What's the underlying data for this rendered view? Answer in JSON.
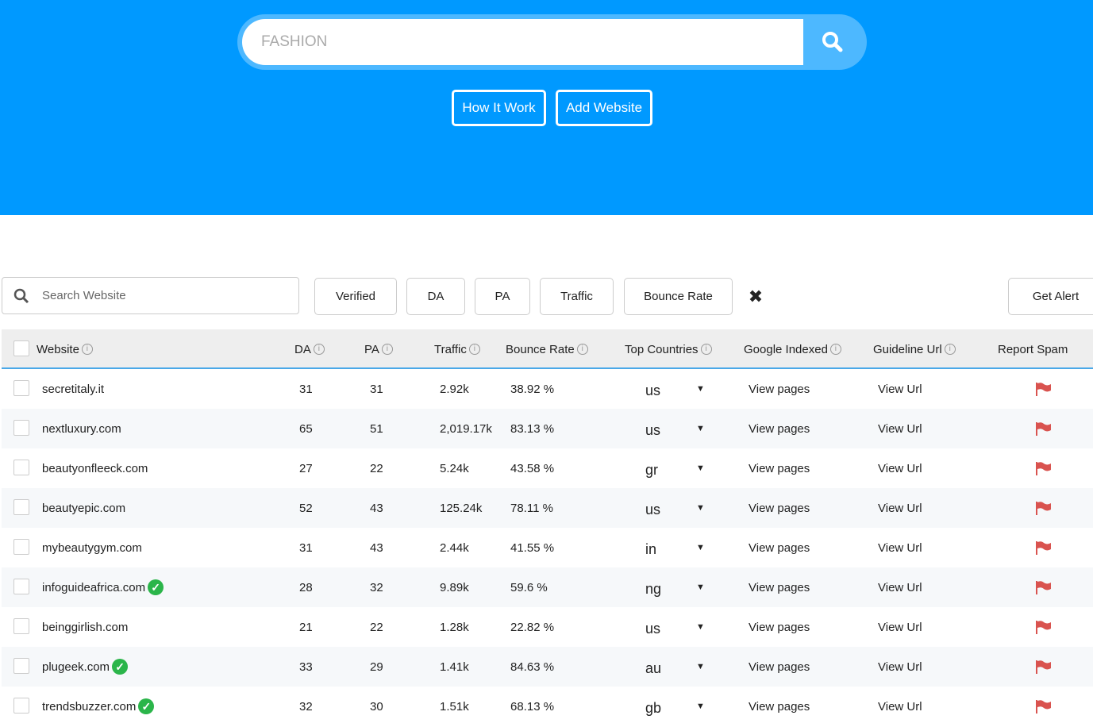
{
  "hero": {
    "search_value": "FASHION",
    "how_it_work": "How It Work",
    "add_website": "Add Website"
  },
  "filters": {
    "search_placeholder": "Search Website",
    "verified": "Verified",
    "da": "DA",
    "pa": "PA",
    "traffic": "Traffic",
    "bounce_rate": "Bounce Rate",
    "clear": "✖",
    "get_alert": "Get Alert"
  },
  "columns": {
    "website": "Website",
    "da": "DA",
    "pa": "PA",
    "traffic": "Traffic",
    "bounce": "Bounce Rate",
    "countries": "Top Countries",
    "indexed": "Google Indexed",
    "guideline": "Guideline Url",
    "spam": "Report Spam"
  },
  "rows": [
    {
      "site": "secretitaly.it",
      "verified": false,
      "da": "31",
      "pa": "31",
      "traffic": "2.92k",
      "bounce": "38.92 %",
      "country": "us",
      "indexed": "View pages",
      "guideline": "View Url"
    },
    {
      "site": "nextluxury.com",
      "verified": false,
      "da": "65",
      "pa": "51",
      "traffic": "2,019.17k",
      "bounce": "83.13 %",
      "country": "us",
      "indexed": "View pages",
      "guideline": "View Url"
    },
    {
      "site": "beautyonfleeck.com",
      "verified": false,
      "da": "27",
      "pa": "22",
      "traffic": "5.24k",
      "bounce": "43.58 %",
      "country": "gr",
      "indexed": "View pages",
      "guideline": "View Url"
    },
    {
      "site": "beautyepic.com",
      "verified": false,
      "da": "52",
      "pa": "43",
      "traffic": "125.24k",
      "bounce": "78.11 %",
      "country": "us",
      "indexed": "View pages",
      "guideline": "View Url"
    },
    {
      "site": "mybeautygym.com",
      "verified": false,
      "da": "31",
      "pa": "43",
      "traffic": "2.44k",
      "bounce": "41.55 %",
      "country": "in",
      "indexed": "View pages",
      "guideline": "View Url"
    },
    {
      "site": "infoguideafrica.com",
      "verified": true,
      "da": "28",
      "pa": "32",
      "traffic": "9.89k",
      "bounce": "59.6 %",
      "country": "ng",
      "indexed": "View pages",
      "guideline": "View Url"
    },
    {
      "site": "beinggirlish.com",
      "verified": false,
      "da": "21",
      "pa": "22",
      "traffic": "1.28k",
      "bounce": "22.82 %",
      "country": "us",
      "indexed": "View pages",
      "guideline": "View Url"
    },
    {
      "site": "plugeek.com",
      "verified": true,
      "da": "33",
      "pa": "29",
      "traffic": "1.41k",
      "bounce": "84.63 %",
      "country": "au",
      "indexed": "View pages",
      "guideline": "View Url"
    },
    {
      "site": "trendsbuzzer.com",
      "verified": true,
      "da": "32",
      "pa": "30",
      "traffic": "1.51k",
      "bounce": "68.13 %",
      "country": "gb",
      "indexed": "View pages",
      "guideline": "View Url"
    }
  ]
}
